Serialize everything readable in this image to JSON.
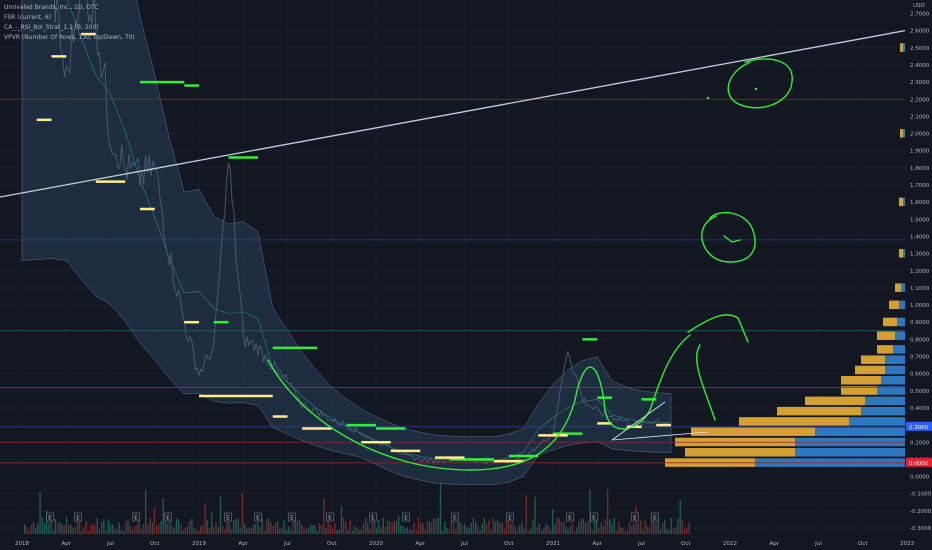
{
  "legend": {
    "symbol": "Unrivaled Brands, Inc., 1D, OTC",
    "indicator1": "FSR (current, 6)",
    "indicator2": "CA_-_RSI_Bol_Strat_1.1 (9, 200)",
    "indicator3": "VPVR (Number Of Rows, 130, Up/Down, 70)"
  },
  "price_axis": {
    "unit_label": "USD",
    "ticks": [
      "2.7000",
      "2.6000",
      "2.5000",
      "2.4000",
      "2.3000",
      "2.2000",
      "2.1000",
      "2.0000",
      "1.9000",
      "1.8000",
      "1.7000",
      "1.6000",
      "1.5000",
      "1.4000",
      "1.3000",
      "1.2000",
      "1.1000",
      "1.0000",
      "0.9000",
      "0.8000",
      "0.7000",
      "0.6000",
      "0.5000",
      "0.4000",
      "0.3000",
      "0.2000",
      "0.1000",
      "0.0000",
      "-0.1000",
      "-0.2000",
      "-0.3000"
    ],
    "last_price_badge": "0.3000",
    "lower_badge": "0.0000"
  },
  "time_axis": {
    "ticks": [
      "2018",
      "Apr",
      "Jul",
      "Oct",
      "2019",
      "Apr",
      "Jul",
      "Oct",
      "2020",
      "Apr",
      "Jul",
      "Oct",
      "2021",
      "Apr",
      "Jul",
      "Oct",
      "2022",
      "Apr",
      "Jul",
      "Oct",
      "2023"
    ],
    "earnings_marker": "E"
  },
  "chart_data": {
    "type": "line",
    "xlabel": "",
    "ylabel": "",
    "x_range": [
      "2018-01",
      "2023-01"
    ],
    "ylim": [
      -0.3,
      2.75
    ],
    "series": [
      {
        "values": [
          {
            "x": "2018-01",
            "y": 3.2
          },
          {
            "x": "2018-03",
            "y": 2.9
          },
          {
            "x": "2018-04",
            "y": 2.3
          },
          {
            "x": "2018-05",
            "y": 2.9
          },
          {
            "x": "2018-06",
            "y": 2.7
          },
          {
            "x": "2018-07",
            "y": 2.0
          },
          {
            "x": "2018-08",
            "y": 1.8
          },
          {
            "x": "2018-09",
            "y": 1.75
          },
          {
            "x": "2018-10",
            "y": 1.8
          },
          {
            "x": "2018-11",
            "y": 1.3
          },
          {
            "x": "2018-12",
            "y": 0.9
          },
          {
            "x": "2019-01",
            "y": 0.6
          },
          {
            "x": "2019-02",
            "y": 0.75
          },
          {
            "x": "2019-03",
            "y": 1.85
          },
          {
            "x": "2019-04",
            "y": 0.8
          },
          {
            "x": "2019-05",
            "y": 0.75
          },
          {
            "x": "2019-06",
            "y": 0.65
          },
          {
            "x": "2019-07",
            "y": 0.55
          },
          {
            "x": "2019-08",
            "y": 0.42
          },
          {
            "x": "2019-09",
            "y": 0.38
          },
          {
            "x": "2019-10",
            "y": 0.33
          },
          {
            "x": "2019-11",
            "y": 0.3
          },
          {
            "x": "2019-12",
            "y": 0.25
          },
          {
            "x": "2020-01",
            "y": 0.2
          },
          {
            "x": "2020-02",
            "y": 0.18
          },
          {
            "x": "2020-03",
            "y": 0.12
          },
          {
            "x": "2020-04",
            "y": 0.1
          },
          {
            "x": "2020-05",
            "y": 0.09
          },
          {
            "x": "2020-06",
            "y": 0.1
          },
          {
            "x": "2020-07",
            "y": 0.1
          },
          {
            "x": "2020-08",
            "y": 0.09
          },
          {
            "x": "2020-09",
            "y": 0.08
          },
          {
            "x": "2020-10",
            "y": 0.09
          },
          {
            "x": "2020-11",
            "y": 0.1
          },
          {
            "x": "2020-12",
            "y": 0.18
          },
          {
            "x": "2021-01",
            "y": 0.25
          },
          {
            "x": "2021-02",
            "y": 0.75
          },
          {
            "x": "2021-03",
            "y": 0.45
          },
          {
            "x": "2021-04",
            "y": 0.38
          },
          {
            "x": "2021-05",
            "y": 0.35
          },
          {
            "x": "2021-06",
            "y": 0.32
          },
          {
            "x": "2021-07",
            "y": 0.3
          },
          {
            "x": "2021-08",
            "y": 0.33
          },
          {
            "x": "2021-09",
            "y": 0.31
          }
        ]
      }
    ],
    "horizontal_levels": [
      2.2,
      1.38,
      0.85,
      0.52,
      0.29,
      0.2,
      0.08
    ],
    "trendline": {
      "start": {
        "x": "2018-01",
        "y": 1.63
      },
      "end": {
        "x": "2023-01",
        "y": 2.6
      }
    },
    "volume_profile_bins": [
      {
        "price": 0.08,
        "up": 0.45,
        "down": 0.75
      },
      {
        "price": 0.14,
        "up": 0.55,
        "down": 0.55
      },
      {
        "price": 0.2,
        "up": 0.6,
        "down": 0.55
      },
      {
        "price": 0.26,
        "up": 0.62,
        "down": 0.45
      },
      {
        "price": 0.32,
        "up": 0.55,
        "down": 0.28
      },
      {
        "price": 0.38,
        "up": 0.42,
        "down": 0.22
      },
      {
        "price": 0.44,
        "up": 0.3,
        "down": 0.2
      },
      {
        "price": 0.5,
        "up": 0.18,
        "down": 0.14
      },
      {
        "price": 0.56,
        "up": 0.2,
        "down": 0.12
      },
      {
        "price": 0.62,
        "up": 0.15,
        "down": 0.1
      },
      {
        "price": 0.68,
        "up": 0.12,
        "down": 0.1
      },
      {
        "price": 0.74,
        "up": 0.08,
        "down": 0.06
      },
      {
        "price": 0.82,
        "up": 0.09,
        "down": 0.05
      },
      {
        "price": 0.9,
        "up": 0.07,
        "down": 0.04
      },
      {
        "price": 1.0,
        "up": 0.05,
        "down": 0.03
      },
      {
        "price": 1.1,
        "up": 0.03,
        "down": 0.02
      },
      {
        "price": 1.3,
        "up": 0.02,
        "down": 0.01
      },
      {
        "price": 1.6,
        "up": 0.02,
        "down": 0.01
      },
      {
        "price": 2.0,
        "up": 0.015,
        "down": 0.01
      },
      {
        "price": 2.5,
        "up": 0.015,
        "down": 0.01
      }
    ]
  },
  "colors": {
    "background": "#131722",
    "price_line": "#4e5b73",
    "band_fill": "#2a4a63",
    "trendline": "#c5cfe0",
    "level_red": "#8a2b2b",
    "level_blue": "#2a3e8a",
    "level_teal": "#1f6b66",
    "green_marks": "#33ee33",
    "yellow_marks": "#ffee88",
    "vp_up": "#d4a033",
    "vp_down": "#2f78c0",
    "badge_blue": "#2962ff",
    "badge_red": "#e0252f"
  }
}
